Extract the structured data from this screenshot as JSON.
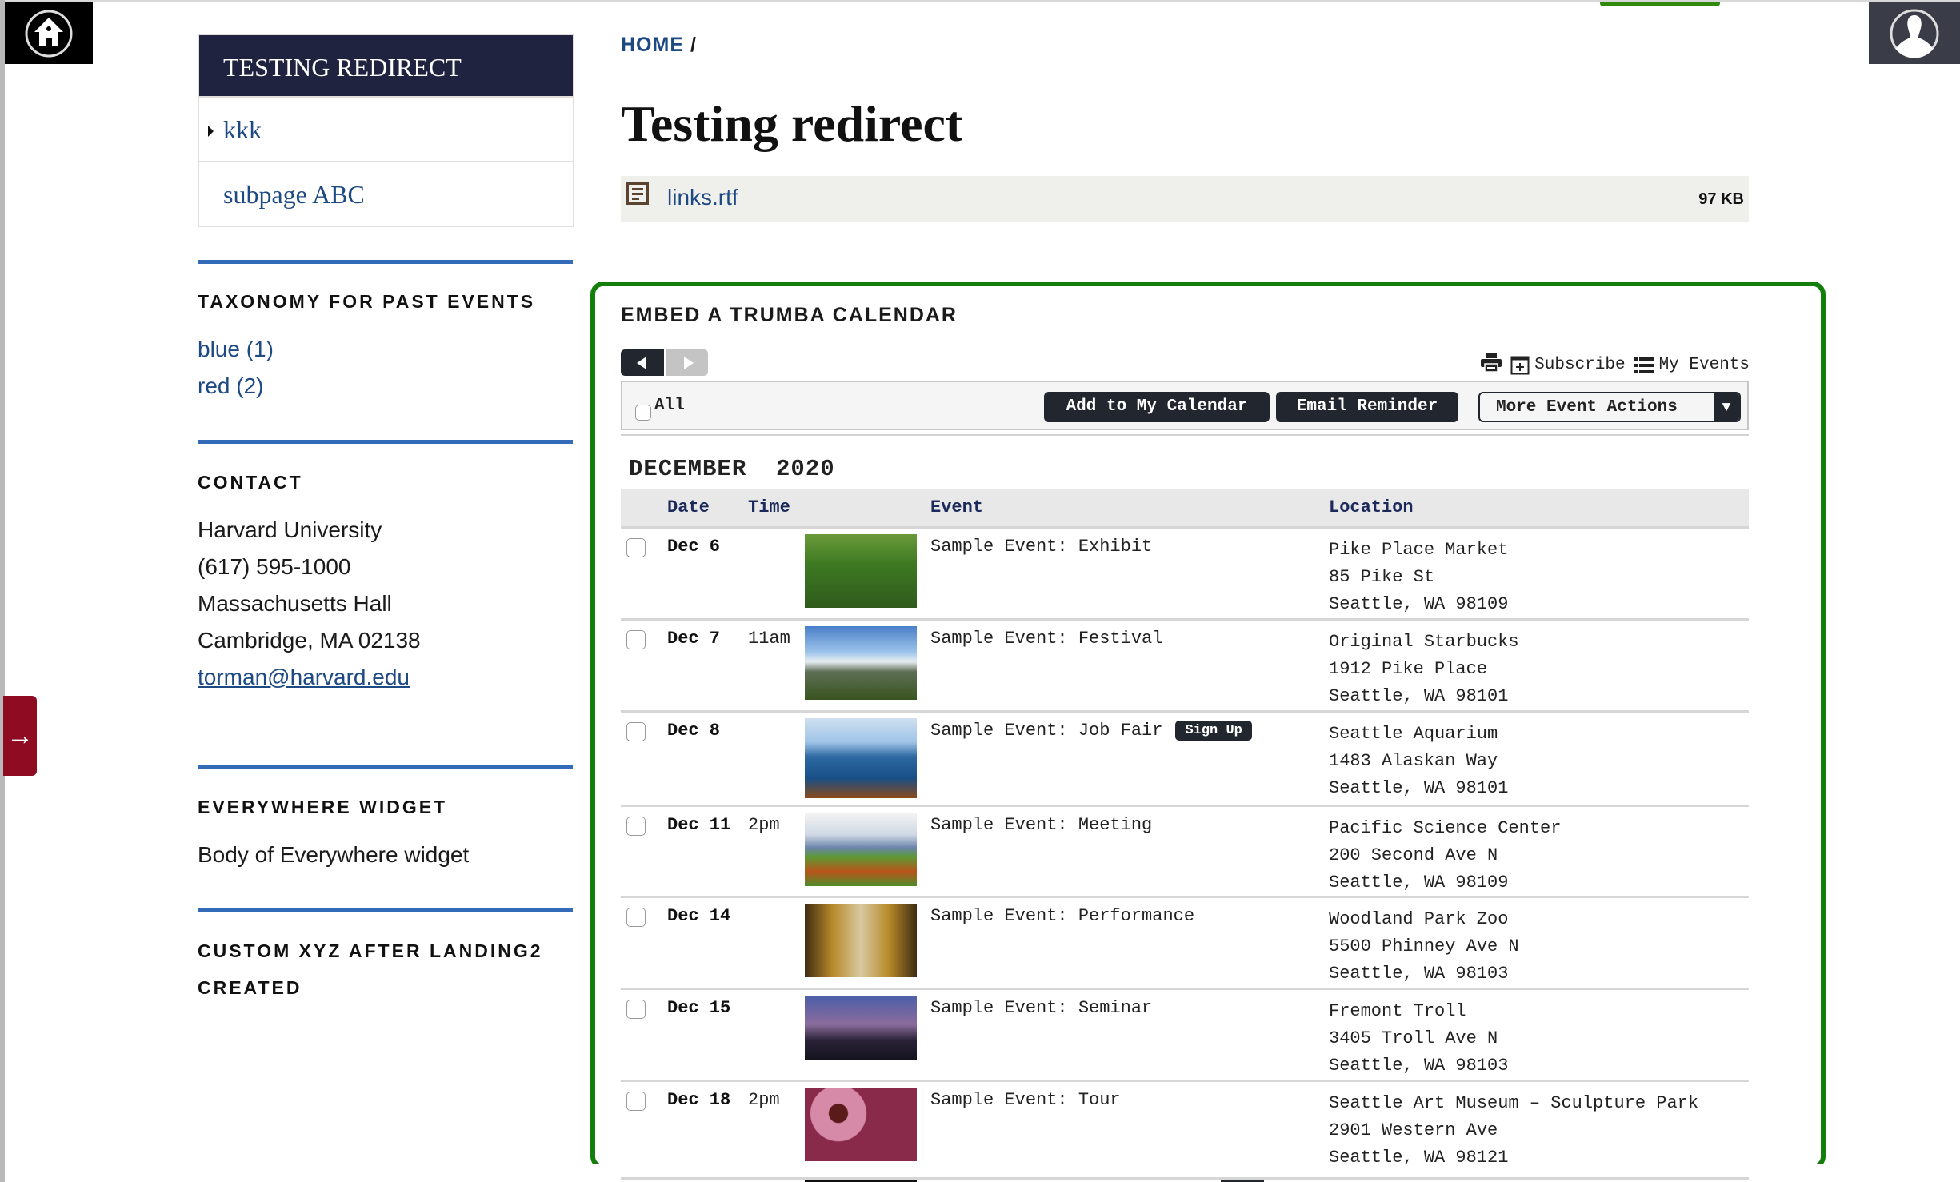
{
  "corner": {
    "home_icon": "home-icon",
    "user_icon": "user-profile-icon",
    "redirect_icon": "arrow-right-icon"
  },
  "sidebar": {
    "menu_title": "TESTING REDIRECT",
    "menu_items": [
      {
        "label": "kkk",
        "active": true
      },
      {
        "label": "subpage ABC",
        "active": false
      }
    ],
    "taxonomy": {
      "heading": "TAXONOMY FOR PAST EVENTS",
      "links": [
        {
          "label": "blue (1)"
        },
        {
          "label": "red (2)"
        }
      ]
    },
    "contact": {
      "heading": "CONTACT",
      "lines": [
        "Harvard University",
        "(617) 595-1000",
        "Massachusetts Hall",
        "Cambridge, MA 02138"
      ],
      "email": "torman@harvard.edu"
    },
    "everywhere": {
      "heading": "EVERYWHERE WIDGET",
      "body": "Body of Everywhere widget"
    },
    "custom": {
      "heading_line1": "CUSTOM XYZ AFTER LANDING2",
      "heading_line2": "CREATED"
    }
  },
  "breadcrumb": {
    "home": "HOME",
    "separator": "/"
  },
  "page": {
    "title": "Testing redirect"
  },
  "attachment": {
    "name": "links.rtf",
    "size": "97 KB",
    "icon": "document-icon"
  },
  "calendar": {
    "title": "EMBED A TRUMBA CALENDAR",
    "links": {
      "print_icon": "printer-icon",
      "subscribe": "Subscribe",
      "my_events": "My Events"
    },
    "toolbar": {
      "all_label": "All",
      "add_to_calendar": "Add to My Calendar",
      "email_reminder": "Email Reminder",
      "more_actions": "More Event Actions",
      "more_arrow": "▼"
    },
    "month": "DECEMBER  2020",
    "columns": {
      "date": "Date",
      "time": "Time",
      "event": "Event",
      "location": "Location"
    },
    "events": [
      {
        "date": "Dec 6",
        "time": "",
        "title": "Sample Event: Exhibit",
        "signup": "",
        "loc": [
          "Pike Place Market",
          "85 Pike St",
          "Seattle, WA 98109"
        ],
        "img": "red-flowers"
      },
      {
        "date": "Dec 7",
        "time": "11am",
        "title": "Sample Event: Festival",
        "signup": "",
        "loc": [
          "Original Starbucks",
          "1912 Pike Place",
          "Seattle, WA 98101"
        ],
        "img": "mountains"
      },
      {
        "date": "Dec 8",
        "time": "",
        "title": "Sample Event: Job Fair",
        "signup": "Sign Up",
        "loc": [
          "Seattle Aquarium",
          "1483 Alaskan Way",
          "Seattle, WA 98101"
        ],
        "img": "sea"
      },
      {
        "date": "Dec 11",
        "time": "2pm",
        "title": "Sample Event: Meeting",
        "signup": "",
        "loc": [
          "Pacific Science Center",
          "200 Second Ave N",
          "Seattle, WA 98109"
        ],
        "img": "dirt-road"
      },
      {
        "date": "Dec 14",
        "time": "",
        "title": "Sample Event: Performance",
        "signup": "",
        "loc": [
          "Woodland Park Zoo",
          "5500 Phinney Ave N",
          "Seattle, WA 98103"
        ],
        "img": "autumn-trees"
      },
      {
        "date": "Dec 15",
        "time": "",
        "title": "Sample Event: Seminar",
        "signup": "",
        "loc": [
          "Fremont Troll",
          "3405 Troll Ave N",
          "Seattle, WA 98103"
        ],
        "img": "city-skyline"
      },
      {
        "date": "Dec 18",
        "time": "2pm",
        "title": "Sample Event: Tour",
        "signup": "",
        "loc": [
          "Seattle Art Museum – Sculpture Park",
          "2901 Western Ave",
          "Seattle, WA 98121"
        ],
        "img": "pink-coneflowers"
      }
    ]
  },
  "colors": {
    "accent_navy": "#20233f",
    "link_blue": "#1e4a84",
    "rule_blue": "#336bb9",
    "calendar_border_green": "#137e0b",
    "button_dark": "#22262e",
    "redirect_red": "#8e0b22"
  }
}
